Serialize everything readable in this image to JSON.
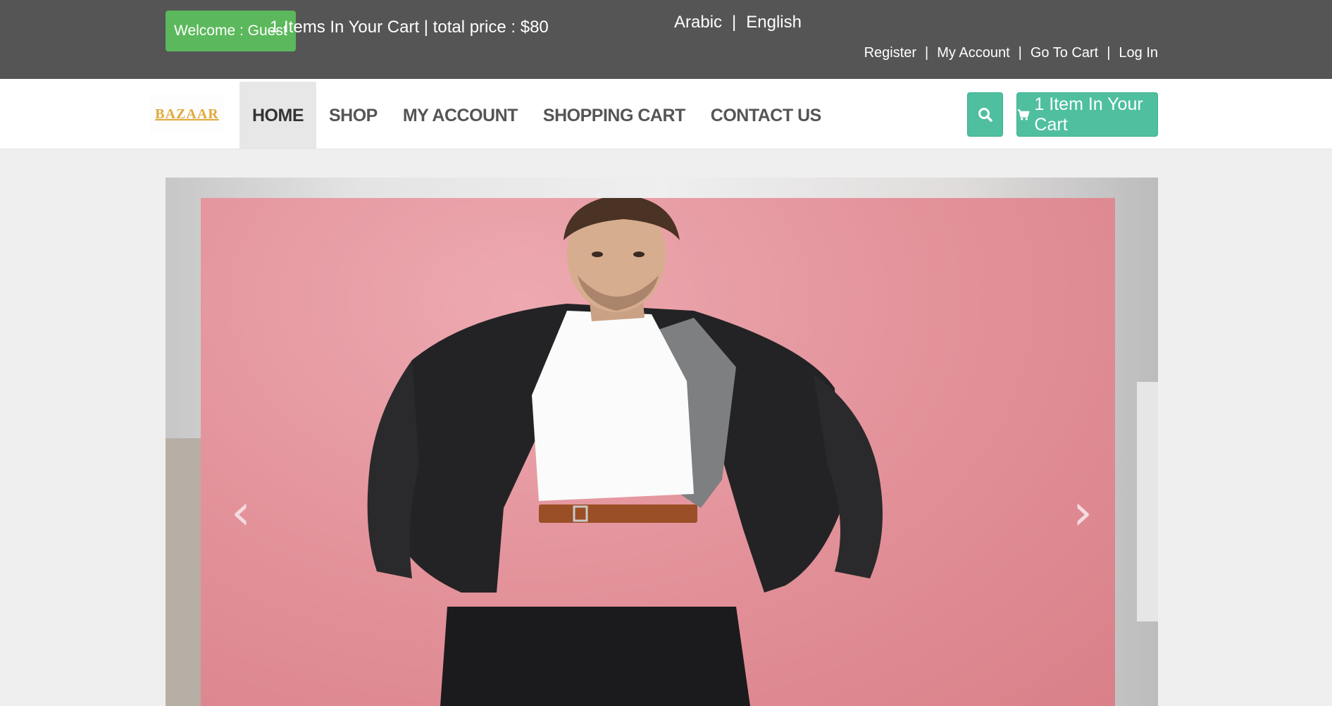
{
  "topbar": {
    "welcome": "Welcome : Guest",
    "cart_summary": "1 Items In Your Cart | total price : $80",
    "languages": [
      "Arabic",
      "English"
    ],
    "links": [
      "Register",
      "My Account",
      "Go To Cart",
      "Log In"
    ]
  },
  "brand": {
    "logo_text": "BAZAAR"
  },
  "nav": {
    "items": [
      "HOME",
      "SHOP",
      "MY ACCOUNT",
      "SHOPPING CART",
      "CONTACT US"
    ],
    "active": "HOME",
    "search_icon": "search-icon",
    "cart_button": "1 Item In Your Cart",
    "cart_icon": "shopping-cart-icon"
  },
  "slider": {
    "prev_icon": "chevron-left-icon",
    "next_icon": "chevron-right-icon",
    "prev_glyph": "‹",
    "next_glyph": "›"
  },
  "colors": {
    "topbar": "#555555",
    "welcome_badge": "#5cb85c",
    "accent": "#4fbfa0",
    "nav_active": "#e7e7e7"
  }
}
